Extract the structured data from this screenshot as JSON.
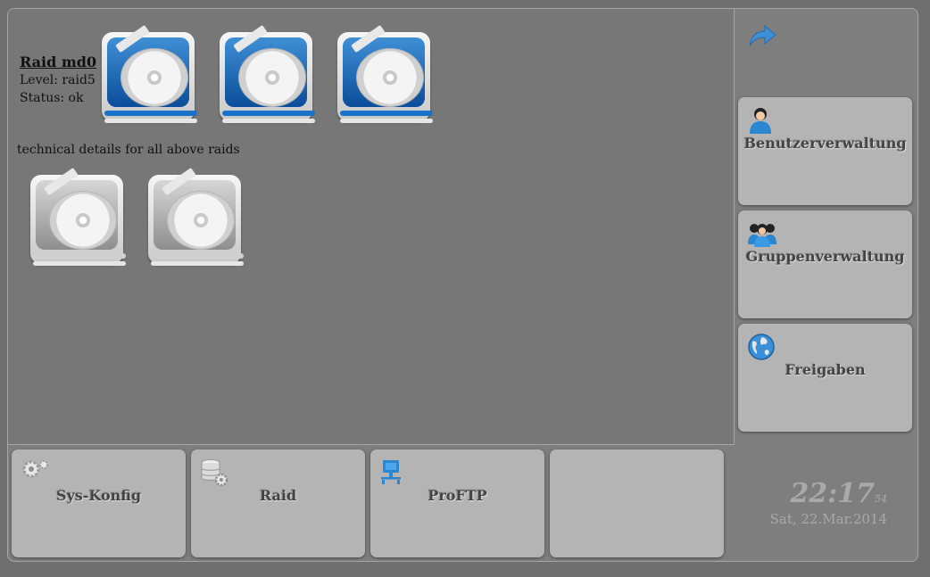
{
  "raid": {
    "title": "Raid md0",
    "level": "Level: raid5",
    "status": "Status: ok"
  },
  "details_caption": "technical details for all above raids",
  "disks": {
    "raid_member_icon": "hard-disk-blue-icon",
    "detail_icon": "hard-disk-gray-icon",
    "raid_member_count": 3,
    "detail_count": 2
  },
  "side_menu": [
    {
      "label": "Benutzerverwaltung",
      "icon": "user-icon"
    },
    {
      "label": "Gruppenverwaltung",
      "icon": "group-icon"
    },
    {
      "label": "Freigaben",
      "icon": "globe-icon"
    }
  ],
  "bottom_menu": [
    {
      "label": "Sys-Konfig",
      "icon": "gears-icon"
    },
    {
      "label": "Raid",
      "icon": "database-gear-icon"
    },
    {
      "label": "ProFTP",
      "icon": "network-computer-icon"
    },
    {
      "label": "",
      "icon": ""
    }
  ],
  "clock": {
    "time": "22:17",
    "seconds": "54",
    "date": "Sat, 22.Mar.2014"
  },
  "colors": {
    "accent_blue": "#1a73c8",
    "button_bg": "#b4b4b4",
    "panel_bg": "#777777"
  }
}
